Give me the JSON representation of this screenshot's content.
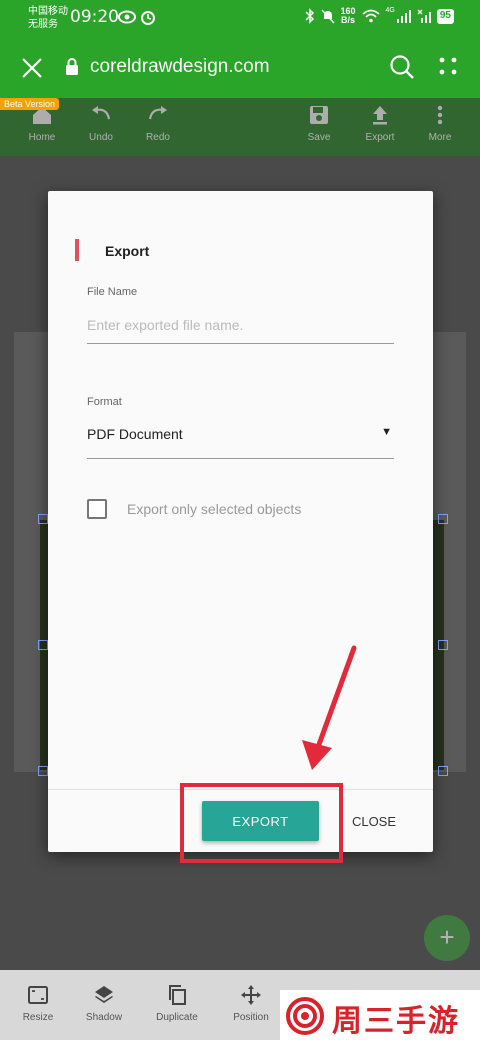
{
  "status_bar": {
    "carrier_line1": "中国移动",
    "carrier_line2": "无服务",
    "time": "09:20",
    "net_speed_value": "160",
    "net_speed_unit": "B/s",
    "signal_tag": "4G",
    "battery": "95"
  },
  "browser": {
    "url": "coreldrawdesign.com",
    "icons": [
      "close-icon",
      "lock-icon",
      "search-icon",
      "more-vert-icon"
    ]
  },
  "app_toolbar": {
    "beta_label": "Beta Version",
    "items": [
      {
        "label": "Home",
        "icon": "home-icon"
      },
      {
        "label": "Undo",
        "icon": "undo-icon"
      },
      {
        "label": "Redo",
        "icon": "redo-icon"
      },
      {
        "label": "Save",
        "icon": "save-icon"
      },
      {
        "label": "Export",
        "icon": "upload-icon"
      },
      {
        "label": "More",
        "icon": "more-vert-icon"
      }
    ]
  },
  "dialog": {
    "title": "Export",
    "file_name_label": "File Name",
    "file_name_value": "",
    "file_name_placeholder": "Enter exported file name.",
    "format_label": "Format",
    "format_value": "PDF Document",
    "checkbox_label": "Export only selected objects",
    "checkbox_checked": false,
    "export_button": "EXPORT",
    "close_button": "CLOSE"
  },
  "bottom_toolbar": {
    "items": [
      {
        "label": "Resize",
        "icon": "resize-icon"
      },
      {
        "label": "Shadow",
        "icon": "layers-icon"
      },
      {
        "label": "Duplicate",
        "icon": "duplicate-icon"
      },
      {
        "label": "Position",
        "icon": "move-icon"
      }
    ]
  },
  "fab": {
    "label": "+"
  },
  "watermark": {
    "text": "周三手游网"
  },
  "colors": {
    "header_green": "#2aa52a",
    "accent_teal": "#27a596",
    "title_accent": "#e3525c",
    "annotation_red": "#e22a3a"
  }
}
